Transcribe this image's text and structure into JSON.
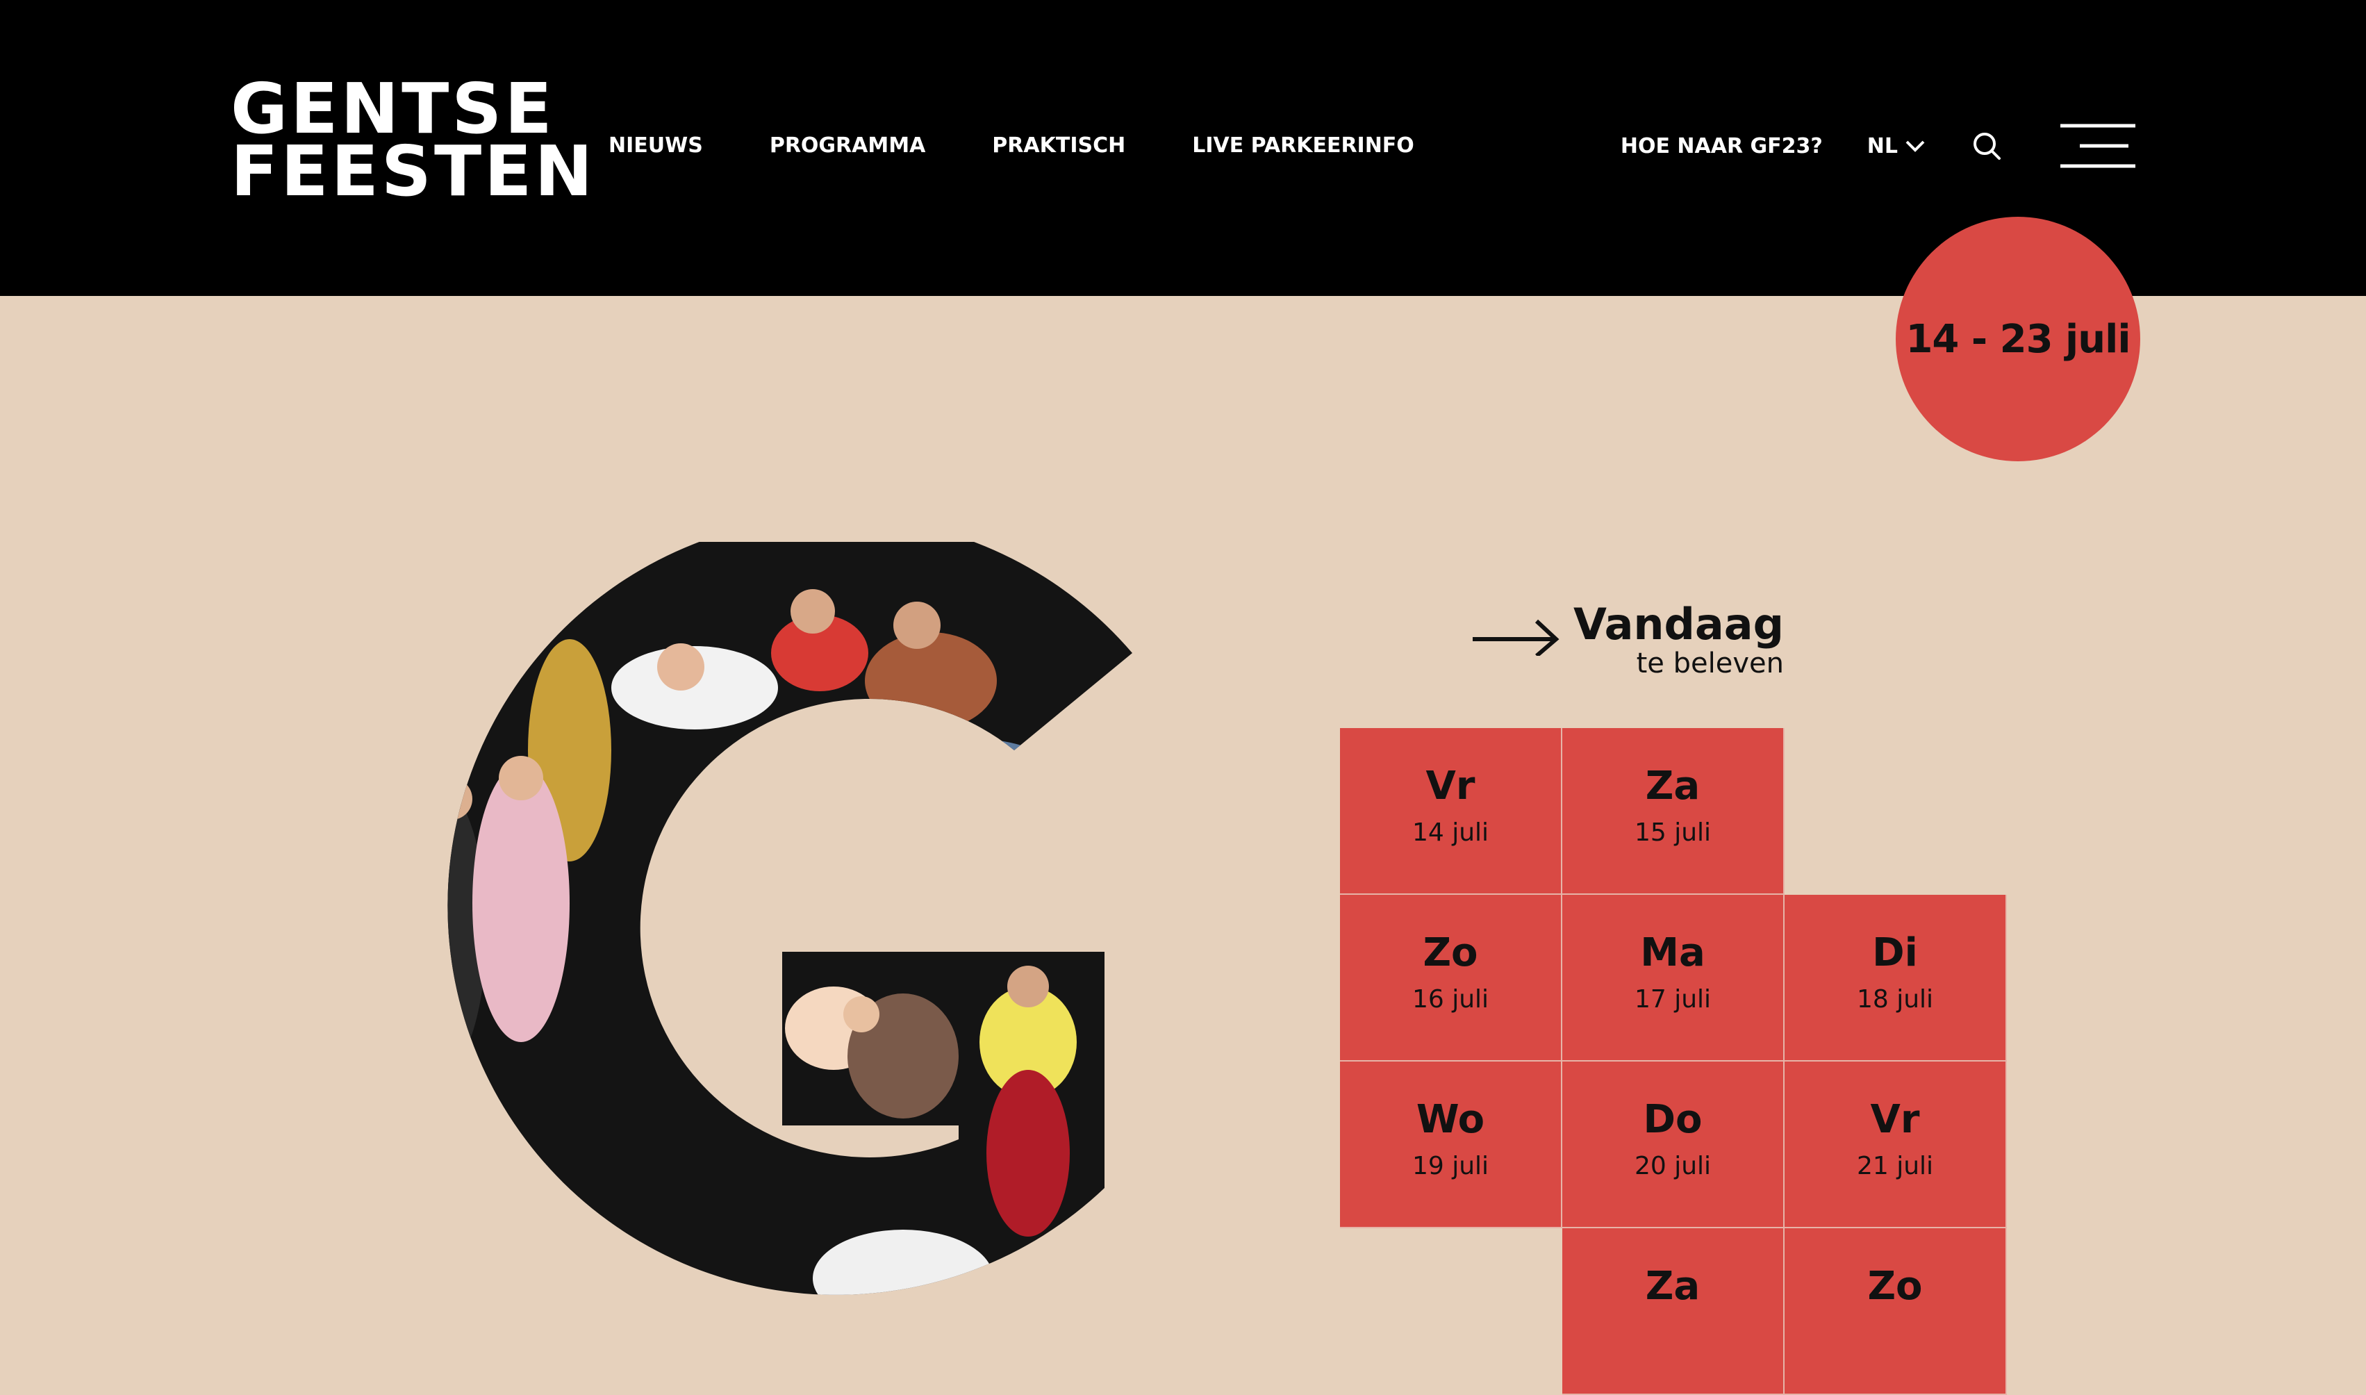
{
  "logo": {
    "line1": "GENTSE",
    "line2": "FEESTEN"
  },
  "nav": {
    "items": [
      "NIEUWS",
      "PROGRAMMA",
      "PRAKTISCH",
      "LIVE PARKEERINFO"
    ]
  },
  "right_nav": {
    "hoe": "HOE NAAR GF23?",
    "lang": "NL"
  },
  "icons": {
    "search": "search-icon",
    "menu": "hamburger-menu-icon",
    "lang": "chevron-down-icon",
    "arrow": "arrow-right-icon"
  },
  "badge": {
    "text": "14 - 23 juli"
  },
  "today": {
    "title": "Vandaag",
    "subtitle": "te beleven"
  },
  "calendar": {
    "days": [
      {
        "name": "Vr",
        "date": "14 juli"
      },
      {
        "name": "Za",
        "date": "15 juli"
      },
      {
        "name": "Zo",
        "date": "16 juli"
      },
      {
        "name": "Ma",
        "date": "17 juli"
      },
      {
        "name": "Di",
        "date": "18 juli"
      },
      {
        "name": "Wo",
        "date": "19 juli"
      },
      {
        "name": "Do",
        "date": "20 juli"
      },
      {
        "name": "Vr",
        "date": "21 juli"
      },
      {
        "name": "Za",
        "date": ""
      },
      {
        "name": "Zo",
        "date": ""
      }
    ]
  },
  "colors": {
    "header_bg": "#000000",
    "page_bg": "#e6d1bc",
    "accent_red": "#d94944"
  }
}
